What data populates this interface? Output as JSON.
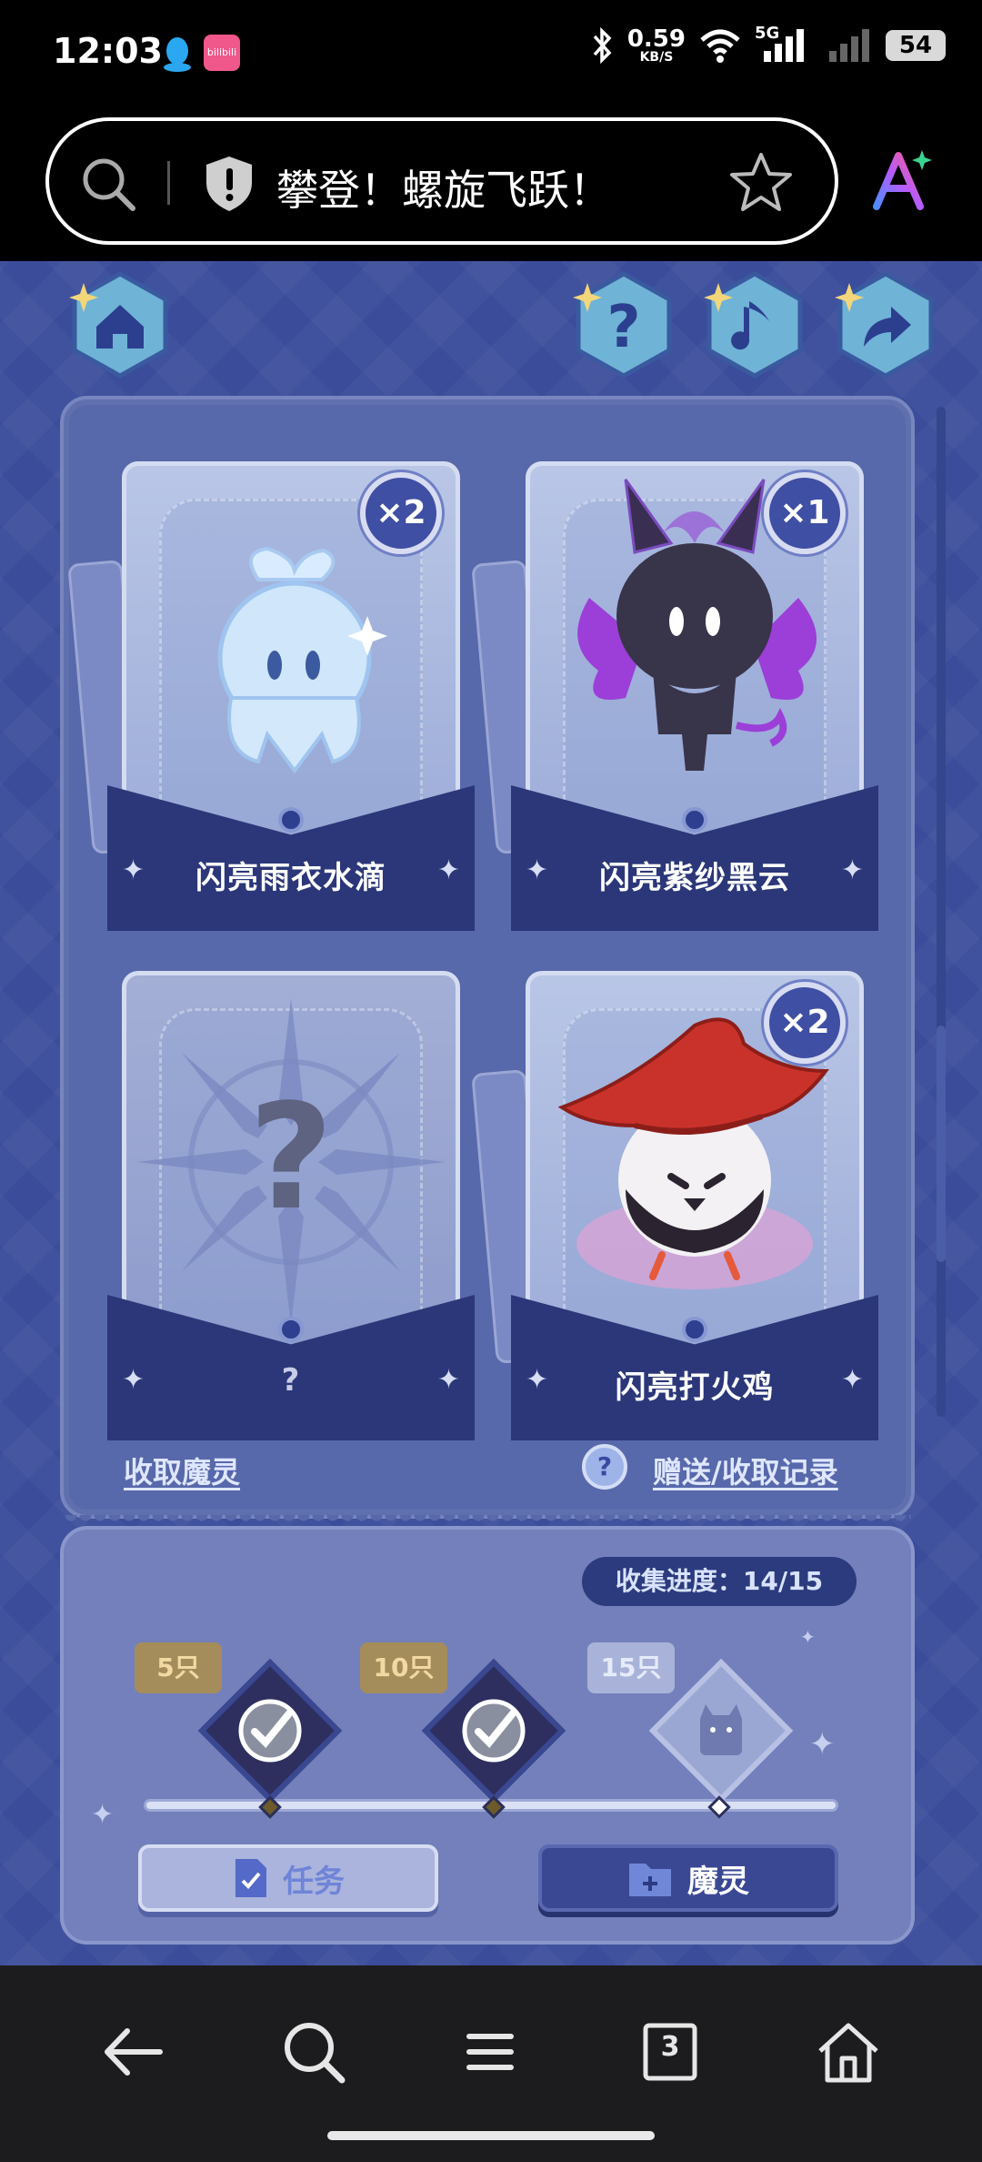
{
  "status_bar": {
    "time": "12:03",
    "app_icon_2_label": "bilibili",
    "net_speed_value": "0.59",
    "net_speed_unit": "KB/S",
    "network_label": "5G",
    "battery": "54"
  },
  "browser": {
    "page_title": "攀登！螺旋飞跃！"
  },
  "game": {
    "cards": [
      {
        "name": "闪亮雨衣水滴",
        "count": "×2"
      },
      {
        "name": "闪亮紫纱黑云",
        "count": "×1"
      },
      {
        "name": "?",
        "count": ""
      },
      {
        "name": "闪亮打火鸡",
        "count": "×2"
      }
    ],
    "collect_link": "收取魔灵",
    "record_link": "赠送/收取记录",
    "help_mark": "?",
    "progress_text": "收集进度：14/15",
    "progress_value": 14,
    "progress_total": 15,
    "milestones": [
      {
        "label": "5只",
        "claimed": true
      },
      {
        "label": "10只",
        "claimed": true
      },
      {
        "label": "15只",
        "claimed": false
      }
    ],
    "tab_task": "任务",
    "tab_spirit": "魔灵"
  },
  "navbar": {
    "tabs_count": "3"
  },
  "colors": {
    "game_bg": "#3a4c9a",
    "panel": "#5768ab",
    "accent_dark": "#2b3779"
  }
}
